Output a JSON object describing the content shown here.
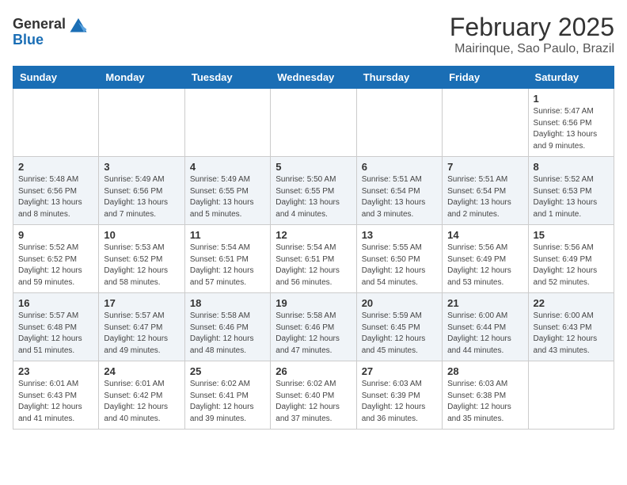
{
  "header": {
    "logo_general": "General",
    "logo_blue": "Blue",
    "month": "February 2025",
    "location": "Mairinque, Sao Paulo, Brazil"
  },
  "weekdays": [
    "Sunday",
    "Monday",
    "Tuesday",
    "Wednesday",
    "Thursday",
    "Friday",
    "Saturday"
  ],
  "weeks": [
    [
      {
        "day": "",
        "info": ""
      },
      {
        "day": "",
        "info": ""
      },
      {
        "day": "",
        "info": ""
      },
      {
        "day": "",
        "info": ""
      },
      {
        "day": "",
        "info": ""
      },
      {
        "day": "",
        "info": ""
      },
      {
        "day": "1",
        "info": "Sunrise: 5:47 AM\nSunset: 6:56 PM\nDaylight: 13 hours\nand 9 minutes."
      }
    ],
    [
      {
        "day": "2",
        "info": "Sunrise: 5:48 AM\nSunset: 6:56 PM\nDaylight: 13 hours\nand 8 minutes."
      },
      {
        "day": "3",
        "info": "Sunrise: 5:49 AM\nSunset: 6:56 PM\nDaylight: 13 hours\nand 7 minutes."
      },
      {
        "day": "4",
        "info": "Sunrise: 5:49 AM\nSunset: 6:55 PM\nDaylight: 13 hours\nand 5 minutes."
      },
      {
        "day": "5",
        "info": "Sunrise: 5:50 AM\nSunset: 6:55 PM\nDaylight: 13 hours\nand 4 minutes."
      },
      {
        "day": "6",
        "info": "Sunrise: 5:51 AM\nSunset: 6:54 PM\nDaylight: 13 hours\nand 3 minutes."
      },
      {
        "day": "7",
        "info": "Sunrise: 5:51 AM\nSunset: 6:54 PM\nDaylight: 13 hours\nand 2 minutes."
      },
      {
        "day": "8",
        "info": "Sunrise: 5:52 AM\nSunset: 6:53 PM\nDaylight: 13 hours\nand 1 minute."
      }
    ],
    [
      {
        "day": "9",
        "info": "Sunrise: 5:52 AM\nSunset: 6:52 PM\nDaylight: 12 hours\nand 59 minutes."
      },
      {
        "day": "10",
        "info": "Sunrise: 5:53 AM\nSunset: 6:52 PM\nDaylight: 12 hours\nand 58 minutes."
      },
      {
        "day": "11",
        "info": "Sunrise: 5:54 AM\nSunset: 6:51 PM\nDaylight: 12 hours\nand 57 minutes."
      },
      {
        "day": "12",
        "info": "Sunrise: 5:54 AM\nSunset: 6:51 PM\nDaylight: 12 hours\nand 56 minutes."
      },
      {
        "day": "13",
        "info": "Sunrise: 5:55 AM\nSunset: 6:50 PM\nDaylight: 12 hours\nand 54 minutes."
      },
      {
        "day": "14",
        "info": "Sunrise: 5:56 AM\nSunset: 6:49 PM\nDaylight: 12 hours\nand 53 minutes."
      },
      {
        "day": "15",
        "info": "Sunrise: 5:56 AM\nSunset: 6:49 PM\nDaylight: 12 hours\nand 52 minutes."
      }
    ],
    [
      {
        "day": "16",
        "info": "Sunrise: 5:57 AM\nSunset: 6:48 PM\nDaylight: 12 hours\nand 51 minutes."
      },
      {
        "day": "17",
        "info": "Sunrise: 5:57 AM\nSunset: 6:47 PM\nDaylight: 12 hours\nand 49 minutes."
      },
      {
        "day": "18",
        "info": "Sunrise: 5:58 AM\nSunset: 6:46 PM\nDaylight: 12 hours\nand 48 minutes."
      },
      {
        "day": "19",
        "info": "Sunrise: 5:58 AM\nSunset: 6:46 PM\nDaylight: 12 hours\nand 47 minutes."
      },
      {
        "day": "20",
        "info": "Sunrise: 5:59 AM\nSunset: 6:45 PM\nDaylight: 12 hours\nand 45 minutes."
      },
      {
        "day": "21",
        "info": "Sunrise: 6:00 AM\nSunset: 6:44 PM\nDaylight: 12 hours\nand 44 minutes."
      },
      {
        "day": "22",
        "info": "Sunrise: 6:00 AM\nSunset: 6:43 PM\nDaylight: 12 hours\nand 43 minutes."
      }
    ],
    [
      {
        "day": "23",
        "info": "Sunrise: 6:01 AM\nSunset: 6:43 PM\nDaylight: 12 hours\nand 41 minutes."
      },
      {
        "day": "24",
        "info": "Sunrise: 6:01 AM\nSunset: 6:42 PM\nDaylight: 12 hours\nand 40 minutes."
      },
      {
        "day": "25",
        "info": "Sunrise: 6:02 AM\nSunset: 6:41 PM\nDaylight: 12 hours\nand 39 minutes."
      },
      {
        "day": "26",
        "info": "Sunrise: 6:02 AM\nSunset: 6:40 PM\nDaylight: 12 hours\nand 37 minutes."
      },
      {
        "day": "27",
        "info": "Sunrise: 6:03 AM\nSunset: 6:39 PM\nDaylight: 12 hours\nand 36 minutes."
      },
      {
        "day": "28",
        "info": "Sunrise: 6:03 AM\nSunset: 6:38 PM\nDaylight: 12 hours\nand 35 minutes."
      },
      {
        "day": "",
        "info": ""
      }
    ]
  ]
}
